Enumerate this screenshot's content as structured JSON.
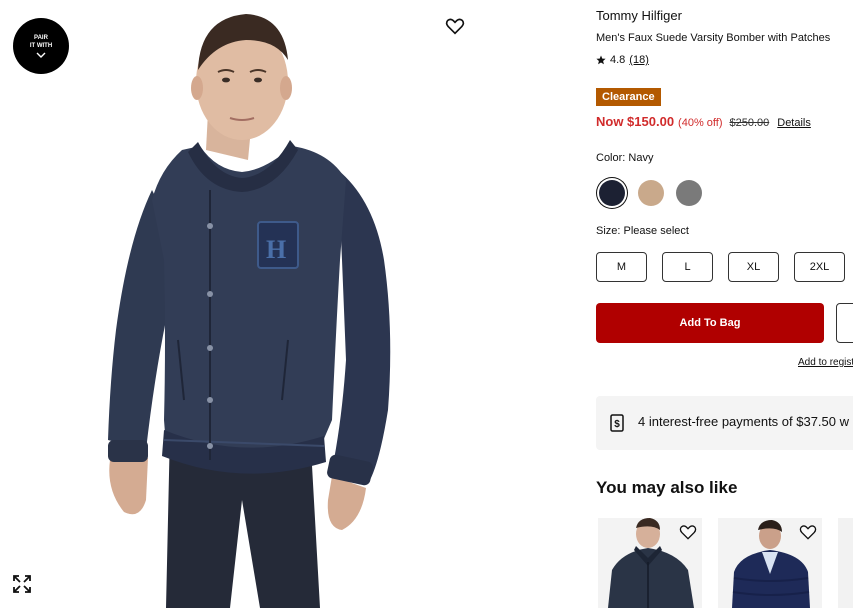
{
  "image_panel": {
    "pair_badge": {
      "line1": "PAIR",
      "line2": "IT WITH"
    }
  },
  "product": {
    "brand": "Tommy Hilfiger",
    "name": "Men's Faux Suede Varsity Bomber with Patches",
    "rating": "4.8",
    "review_count": "(18)",
    "badge": "Clearance",
    "now_price": "Now $150.00",
    "discount": "(40% off)",
    "original_price": "$250.00",
    "details_link": "Details"
  },
  "color": {
    "label": "Color: Navy",
    "swatches": [
      {
        "name": "Navy",
        "hex": "#1c2133",
        "selected": true
      },
      {
        "name": "Tan",
        "hex": "#c9a98b",
        "selected": false
      },
      {
        "name": "Grey",
        "hex": "#7a7a7a",
        "selected": false
      }
    ]
  },
  "size": {
    "label": "Size: Please select",
    "options": [
      "M",
      "L",
      "XL",
      "2XL"
    ]
  },
  "actions": {
    "add_to_bag": "Add To Bag",
    "registry": "Add to regist"
  },
  "installment": {
    "text": "4 interest-free payments of $37.50 w"
  },
  "recommendations": {
    "title": "You may also like"
  },
  "colors": {
    "accent_red": "#b00000",
    "price_red": "#d12b2b",
    "clearance_orange": "#b35900"
  }
}
